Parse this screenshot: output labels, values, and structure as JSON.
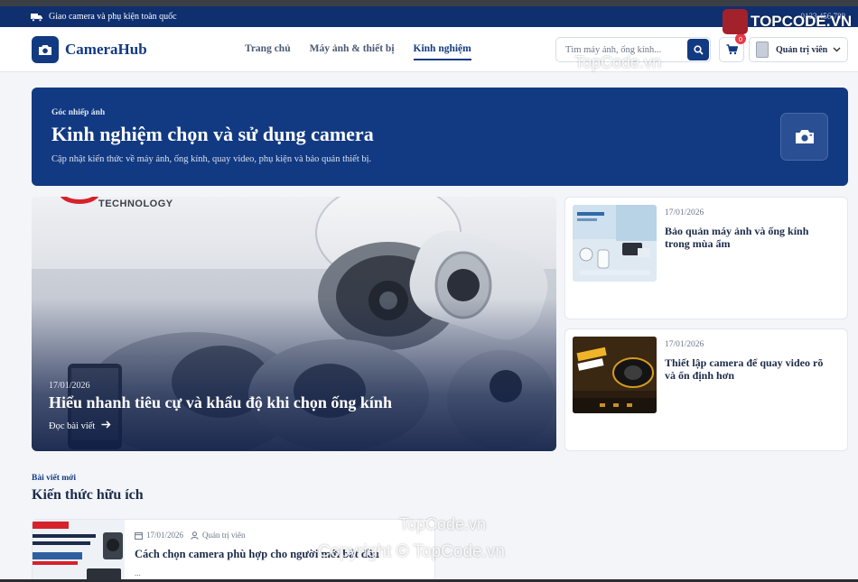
{
  "topbar": {
    "shipping_text": "Giao camera và phụ kiện toàn quốc",
    "hotline_text": "0123 456 789"
  },
  "header": {
    "logo_text": "CameraHub",
    "nav": [
      {
        "label": "Trang chủ"
      },
      {
        "label": "Máy ảnh & thiết bị"
      },
      {
        "label": "Kinh nghiệm",
        "active": true
      }
    ],
    "search_placeholder": "Tìm máy ảnh, ống kính...",
    "cart_count": "0",
    "user_label": "Quản trị viên"
  },
  "hero": {
    "kicker": "Góc nhiếp ảnh",
    "title": "Kinh nghiệm chọn và sử dụng camera",
    "description": "Cập nhật kiến thức về máy ảnh, ống kính, quay video, phụ kiện và bảo quản thiết bị."
  },
  "featured": {
    "brand_text": "TECHNOLOGY",
    "image_brand": "alhua",
    "date": "17/01/2026",
    "title": "Hiểu nhanh tiêu cự và khẩu độ khi chọn ống kính",
    "read_more": "Đọc bài viết"
  },
  "side_posts": [
    {
      "date": "17/01/2026",
      "title": "Bảo quản máy ảnh và ống kính trong mùa ẩm"
    },
    {
      "date": "17/01/2026",
      "title": "Thiết lập camera để quay video rõ và ổn định hơn"
    }
  ],
  "section": {
    "kicker": "Bài viết mới",
    "title": "Kiến thức hữu ích"
  },
  "recent_post": {
    "date": "17/01/2026",
    "author": "Quản trị viên",
    "title": "Cách chọn camera phù hợp cho người mới bắt đầu",
    "excerpt": "..."
  },
  "watermark": {
    "logo_text": "TOPCODE.VN",
    "site": "TopCode.vn",
    "copyright": "Copyright © TopCode.vn"
  },
  "colors": {
    "primary": "#123a82",
    "topbar": "#0f2f6e",
    "accent_red": "#e63946",
    "background": "#f3f5f9"
  }
}
